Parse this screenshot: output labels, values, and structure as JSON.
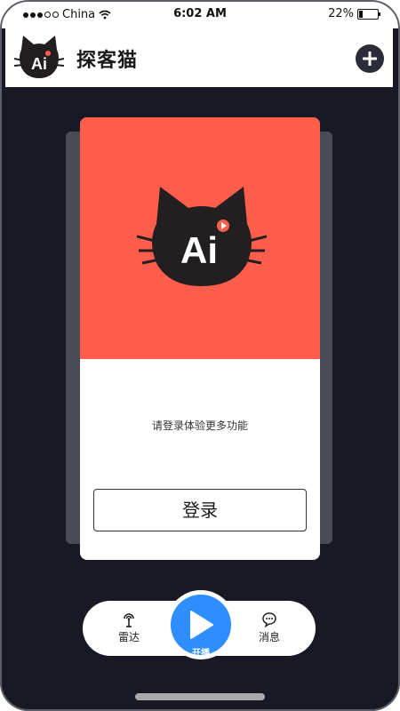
{
  "status_bar": {
    "carrier": "China",
    "time": "6:02 AM",
    "battery_percent": "22%",
    "battery_level": 0.22
  },
  "header": {
    "title": "探客猫",
    "logo_text": "Ai",
    "add_icon": "plus-circle-icon"
  },
  "card": {
    "logo_text": "Ai",
    "message": "请登录体验更多功能",
    "login_label": "登录",
    "accent_color": "#fe5e4b"
  },
  "bottom_nav": {
    "items": [
      {
        "label": "雷达",
        "icon": "radar-icon"
      },
      {
        "label": "开播",
        "icon": "play-icon"
      },
      {
        "label": "消息",
        "icon": "chat-bubble-icon"
      }
    ],
    "play_color": "#2e8eff"
  }
}
